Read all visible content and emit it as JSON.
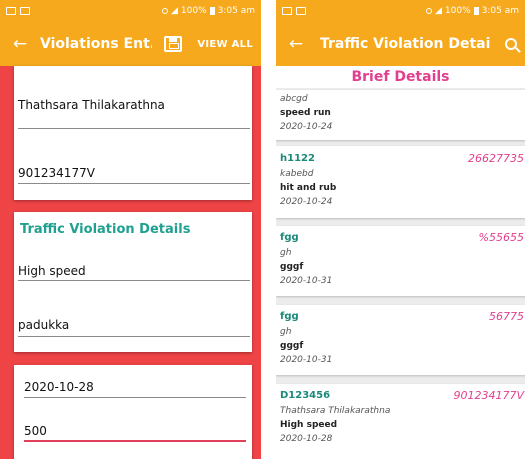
{
  "status": {
    "battery": "100%",
    "time": "3:05 am"
  },
  "left": {
    "title": "Violations Ent...",
    "view_all": "VIEW ALL",
    "fields": {
      "driver_name": "Thathsara Thilakarathna",
      "nic": "901234177V",
      "section_title": "Traffic Violation Details",
      "violation": "High speed",
      "location": "padukka",
      "date": "2020-10-28",
      "fine": "500"
    }
  },
  "right": {
    "title": "Traffic Violation Details",
    "brief_title": "Brief Details",
    "records": [
      {
        "name": "abcgd",
        "violation": "speed run",
        "date": "2020-10-24"
      },
      {
        "code": "h1122",
        "number": "26627735",
        "name": "kabebd",
        "violation": "hit and rub",
        "date": "2020-10-24"
      },
      {
        "code": "fgg",
        "number": "%55655",
        "name": "gh",
        "violation": "gggf",
        "date": "2020-10-31"
      },
      {
        "code": "fgg",
        "number": "56775",
        "name": "gh",
        "violation": "gggf",
        "date": "2020-10-31"
      },
      {
        "code": "D123456",
        "number": "901234177V",
        "name": "Thathsara Thilakarathna",
        "violation": "High speed",
        "date": "2020-10-28"
      }
    ]
  }
}
